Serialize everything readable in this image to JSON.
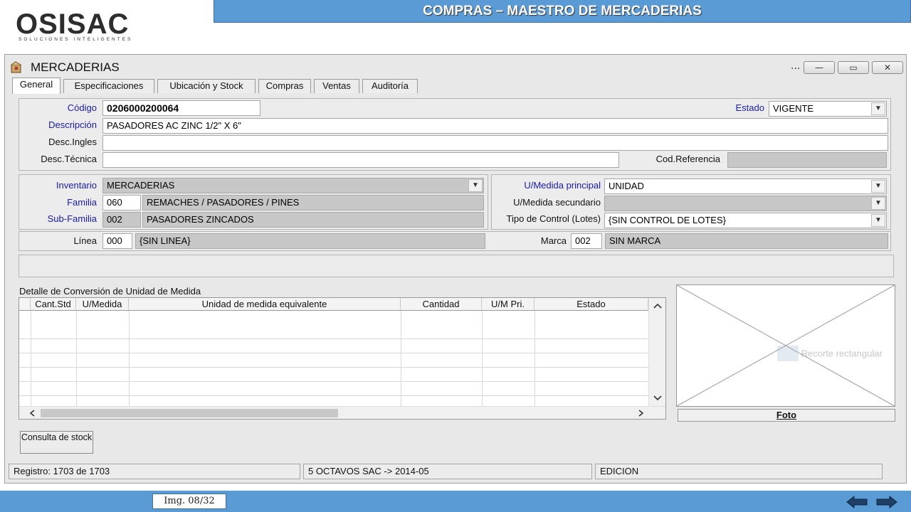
{
  "slide": {
    "logo_text": "OSISAC",
    "logo_sub": "SOLUCIONES INTELIGENTES",
    "title": "COMPRAS – MAESTRO DE MERCADERIAS",
    "image_counter": "Img. 08/32"
  },
  "window": {
    "title": "MERCADERIAS",
    "dots": "...",
    "minimize": "—",
    "maximize": "▭",
    "close": "✕"
  },
  "tabs": [
    "General",
    "Especificaciones",
    "Ubicación y Stock",
    "Compras",
    "Ventas",
    "Auditoría"
  ],
  "header": {
    "codigo_label": "Código",
    "codigo_value": "0206000200064",
    "estado_label": "Estado",
    "estado_value": "VIGENTE",
    "descripcion_label": "Descripción",
    "descripcion_value": "PASADORES AC ZINC 1/2\" X 6\"",
    "desc_ingles_label": "Desc.Ingles",
    "desc_ingles_value": "",
    "desc_tecnica_label": "Desc.Técnica",
    "desc_tecnica_value": "",
    "cod_referencia_label": "Cod.Referencia",
    "cod_referencia_value": ""
  },
  "clasificacion": {
    "inventario_label": "Inventario",
    "inventario_value": "MERCADERIAS",
    "familia_label": "Familia",
    "familia_code": "060",
    "familia_desc": "REMACHES / PASADORES / PINES",
    "subfamilia_label": "Sub-Familia",
    "subfamilia_code": "002",
    "subfamilia_desc": "PASADORES ZINCADOS",
    "um_principal_label": "U/Medida principal",
    "um_principal_value": "UNIDAD",
    "um_secundario_label": "U/Medida secundario",
    "um_secundario_value": "",
    "tipo_control_label": "Tipo de Control (Lotes)",
    "tipo_control_value": "{SIN CONTROL DE LOTES}",
    "linea_label": "Línea",
    "linea_code": "000",
    "linea_desc": "{SIN LINEA}",
    "marca_label": "Marca",
    "marca_code": "002",
    "marca_desc": "SIN MARCA"
  },
  "conversion_grid": {
    "title": "Detalle de Conversión de Unidad de Medida",
    "columns": [
      "Cant.Std",
      "U/Medida",
      "Unidad de medida equivalente",
      "Cantidad",
      "U/M Pri.",
      "Estado"
    ]
  },
  "photo": {
    "label": "Foto",
    "snip_ghost": "Recorte rectangular"
  },
  "commands": {
    "consulta_stock": "Consulta de stock"
  },
  "status": {
    "registro": "Registro: 1703 de 1703",
    "empresa": "5 OCTAVOS SAC -> 2014-05",
    "modo": "EDICION"
  },
  "icons": {
    "window_icon": "package-icon",
    "dropdown": "chevron-down-icon",
    "prev": "arrow-left-icon",
    "next": "arrow-right-icon"
  },
  "colors": {
    "slide_blue": "#5b9bd5",
    "label_blue": "#1a1aa8",
    "readonly_gray": "#c7c7c7"
  }
}
